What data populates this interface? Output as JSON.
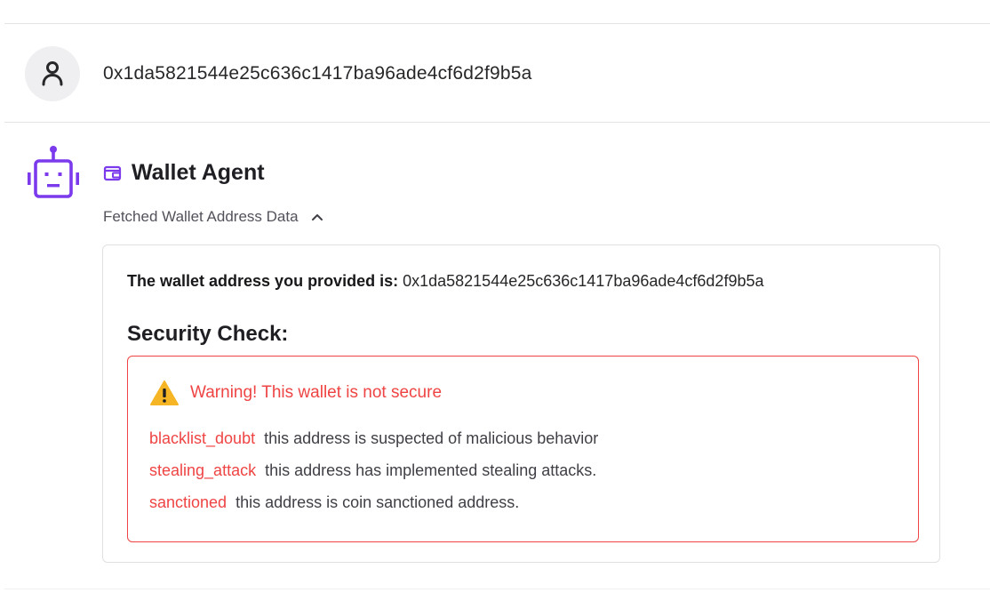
{
  "user_message": {
    "text": "0x1da5821544e25c636c1417ba96ade4cf6d2f9b5a",
    "avatar_icon": "user-icon"
  },
  "agent": {
    "icon": "robot-icon",
    "title_icon": "wallet-icon",
    "title": "Wallet Agent",
    "toggle_label": "Fetched Wallet Address Data",
    "toggle_icon": "chevron-up-icon",
    "card": {
      "address_label": "The wallet address you provided is:",
      "address_value": "0x1da5821544e25c636c1417ba96ade4cf6d2f9b5a",
      "security_title": "Security Check:",
      "warning": {
        "icon": "warning-icon",
        "title": "Warning! This wallet is not secure",
        "items": [
          {
            "code": "blacklist_doubt",
            "description": "this address is suspected of malicious behavior"
          },
          {
            "code": "stealing_attack",
            "description": "this address has implemented stealing attacks."
          },
          {
            "code": "sanctioned",
            "description": "this address is coin sanctioned address."
          }
        ]
      }
    }
  },
  "colors": {
    "accent_purple": "#7c3aed",
    "warning_red": "#ef4444",
    "warning_yellow": "#f5b524"
  }
}
